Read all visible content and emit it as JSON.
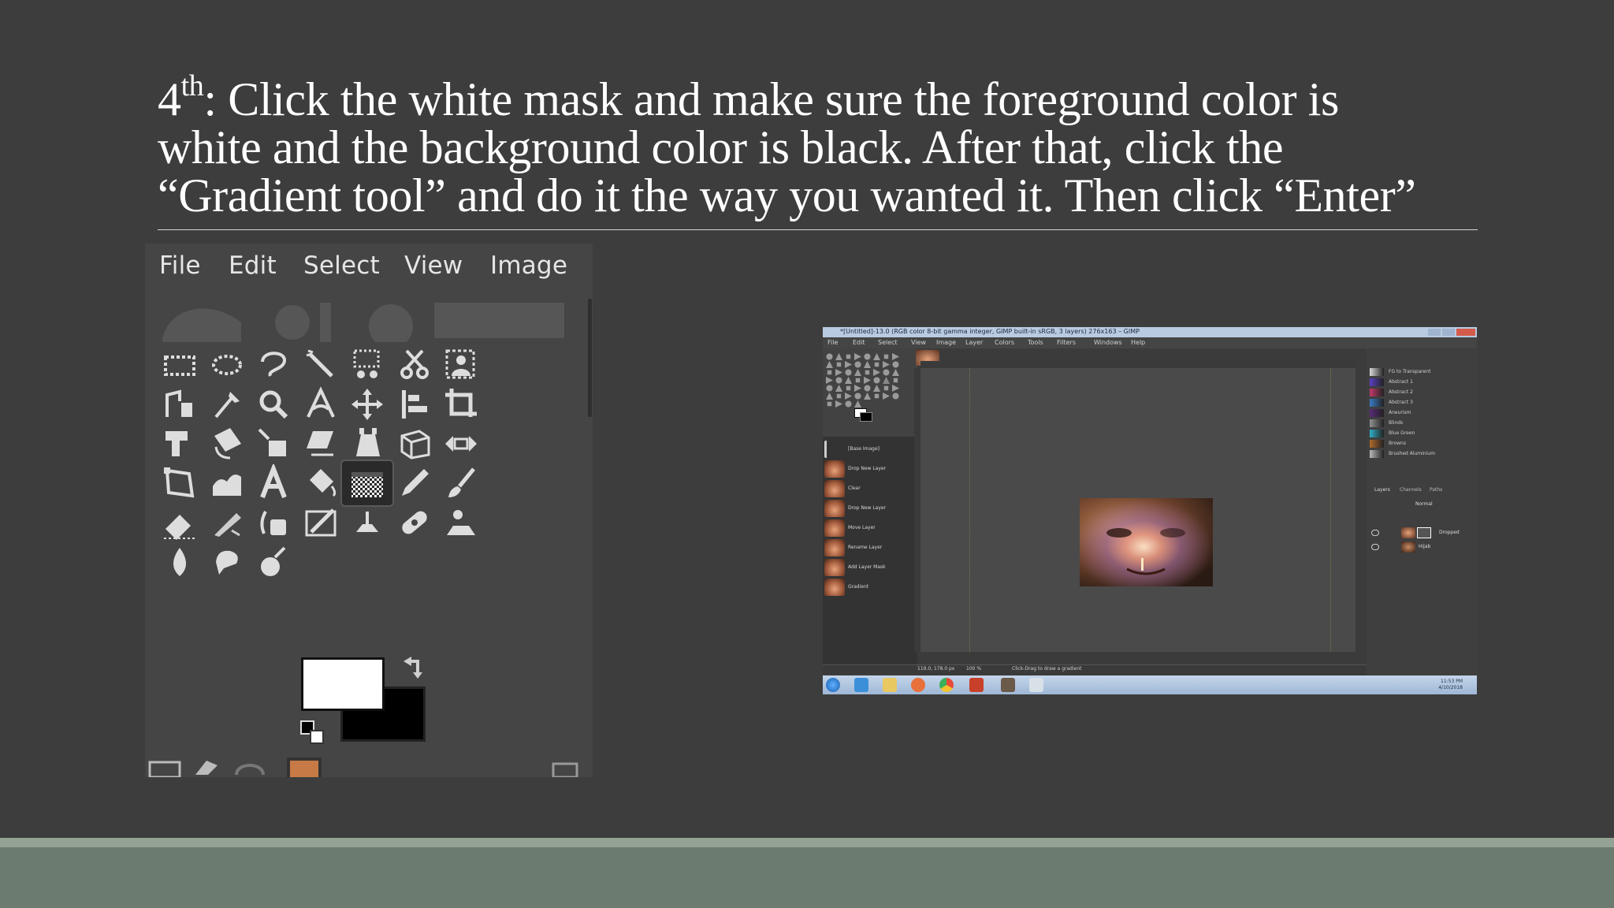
{
  "slide": {
    "title_lines": [
      {
        "pre": "4",
        "sup": "th",
        "text": ": Click the white mask and make sure the foreground color is"
      },
      {
        "text": "white and the background color is black. After that, click the"
      },
      {
        "text": "“Gradient tool” and do it the way you wanted it. Then click “Enter”"
      }
    ],
    "colors": {
      "background": "#3d3d3d",
      "footer": "#6b7b6f",
      "footer_accent": "#93a293",
      "title": "#ffffff"
    }
  },
  "toolbox": {
    "menu": [
      "File",
      "Edit",
      "Select",
      "View",
      "Image"
    ],
    "tools": [
      "rect-select-icon",
      "ellipse-select-icon",
      "free-select-icon",
      "fuzzy-select-icon",
      "select-by-color-icon",
      "scissors-select-icon",
      "foreground-select-icon",
      "paths-icon",
      "color-picker-icon",
      "zoom-icon",
      "measure-icon",
      "move-icon",
      "align-icon",
      "crop-icon",
      "unified-transform-icon",
      "rotate-icon",
      "scale-icon",
      "shear-icon",
      "perspective-icon",
      "3d-transform-icon",
      "flip-icon",
      "cage-transform-icon",
      "warp-transform-icon",
      "text-icon",
      "bucket-fill-icon",
      "gradient-icon",
      "pencil-icon",
      "paintbrush-icon",
      "eraser-icon",
      "airbrush-icon",
      "ink-icon",
      "mypaint-brush-icon",
      "clone-icon",
      "heal-icon",
      "perspective-clone-icon",
      "blur-sharpen-icon",
      "smudge-icon",
      "dodge-burn-icon"
    ],
    "active_tool": "gradient-icon",
    "foreground_color": "#ffffff",
    "background_color": "#000000"
  },
  "gimp_window": {
    "title": "*[Untitled]-13.0 (RGB color 8-bit gamma integer, GIMP built-in sRGB, 3 layers) 276x163 – GIMP",
    "menu": [
      "File",
      "Edit",
      "Select",
      "View",
      "Image",
      "Layer",
      "Colors",
      "Tools",
      "Filters",
      "Windows",
      "Help"
    ],
    "history": [
      "[Base Image]",
      "Drop New Layer",
      "Clear",
      "Drop New Layer",
      "Move Layer",
      "Rename Layer",
      "Add Layer Mask",
      "Gradient"
    ],
    "gradients": [
      {
        "label": "FG to Transparent",
        "color": "#d9d9d9"
      },
      {
        "label": "Abstract 1",
        "color": "#5b3fc4"
      },
      {
        "label": "Abstract 2",
        "color": "#c43a6a"
      },
      {
        "label": "Abstract 3",
        "color": "#3a7cc4"
      },
      {
        "label": "Aneurism",
        "color": "#5a2a7a"
      },
      {
        "label": "Blinds",
        "color": "#909090"
      },
      {
        "label": "Blue Green",
        "color": "#2fb0c8"
      },
      {
        "label": "Browns",
        "color": "#b06a2a"
      },
      {
        "label": "Brushed Aluminium",
        "color": "#b8b8b8"
      }
    ],
    "layers_tabs": [
      "Layers",
      "Channels",
      "Paths"
    ],
    "layer_mode": "Normal",
    "layers": [
      "Dropped",
      "Hijab"
    ],
    "status": "Click-Drag to draw a gradient",
    "coords": "119.0, 178.0",
    "units": "px",
    "zoom": "100 %",
    "clock_time": "11:53 PM",
    "clock_date": "4/10/2018"
  }
}
